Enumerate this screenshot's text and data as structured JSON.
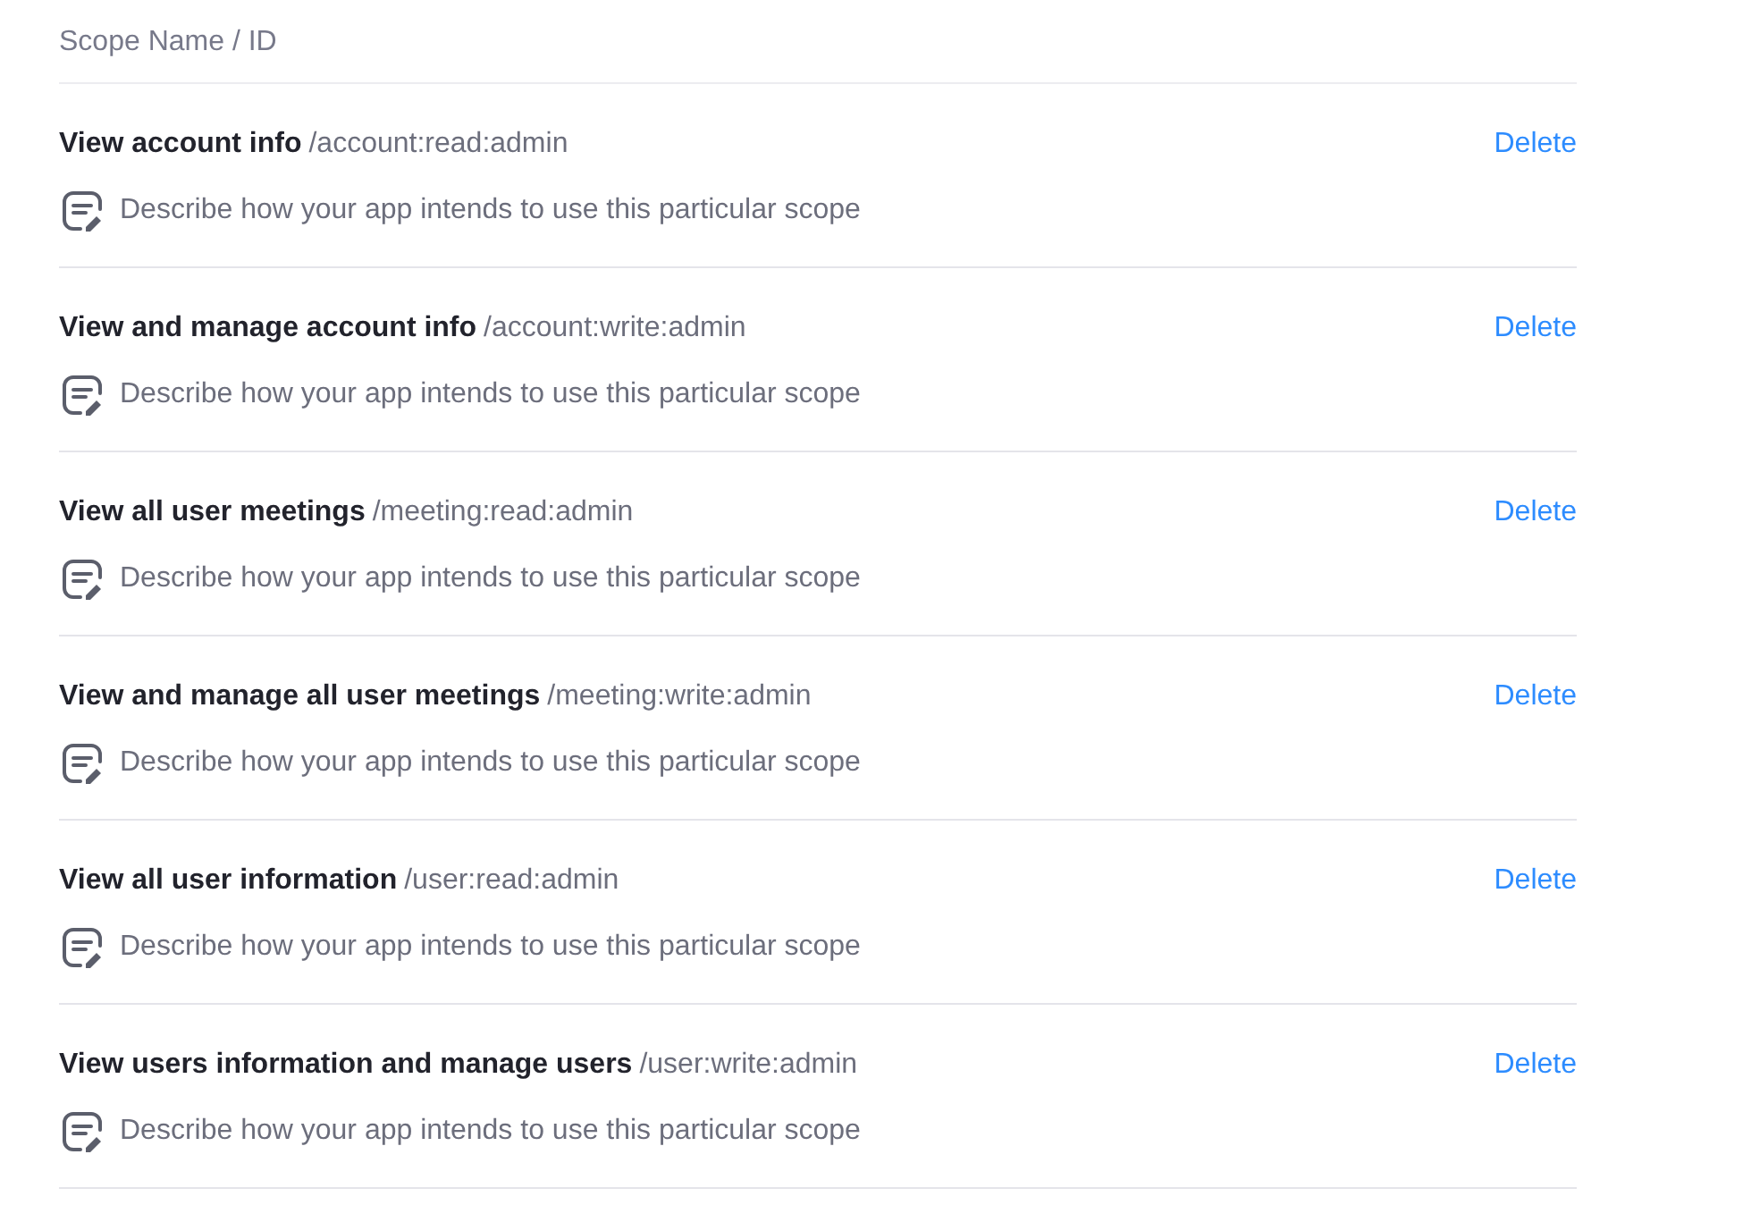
{
  "header": "Scope Name / ID",
  "scopes": [
    {
      "name": "View account info",
      "id": "/account:read:admin",
      "description": "Describe how your app intends to use this particular scope",
      "action": "Delete"
    },
    {
      "name": "View and manage account info",
      "id": "/account:write:admin",
      "description": "Describe how your app intends to use this particular scope",
      "action": "Delete"
    },
    {
      "name": "View all user meetings",
      "id": "/meeting:read:admin",
      "description": "Describe how your app intends to use this particular scope",
      "action": "Delete"
    },
    {
      "name": "View and manage all user meetings",
      "id": "/meeting:write:admin",
      "description": "Describe how your app intends to use this particular scope",
      "action": "Delete"
    },
    {
      "name": "View all user information",
      "id": "/user:read:admin",
      "description": "Describe how your app intends to use this particular scope",
      "action": "Delete"
    },
    {
      "name": "View users information and manage users",
      "id": "/user:write:admin",
      "description": "Describe how your app intends to use this particular scope",
      "action": "Delete"
    }
  ]
}
